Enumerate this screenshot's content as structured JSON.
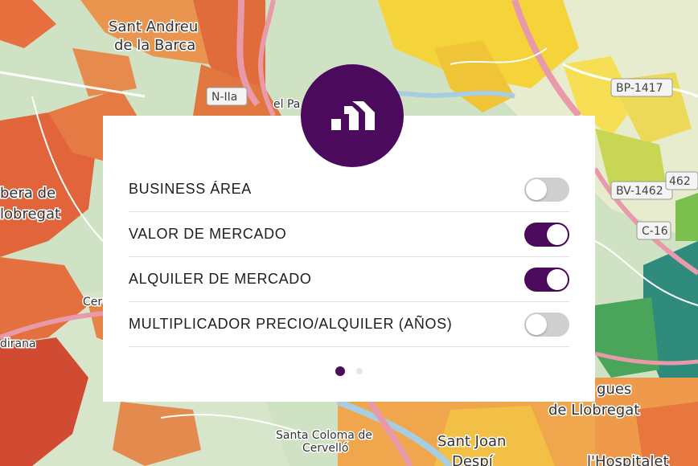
{
  "map": {
    "places": [
      {
        "name": "Sant Andreu"
      },
      {
        "name": "de la Barca"
      },
      {
        "name": "bera de"
      },
      {
        "name": "lobregat"
      },
      {
        "name": "el Pa"
      },
      {
        "name": "Cer"
      },
      {
        "name": "dirana"
      },
      {
        "name": "Santa Coloma de"
      },
      {
        "name": "Cervelló"
      },
      {
        "name": "Sant Joan"
      },
      {
        "name": "Despí"
      },
      {
        "name": "gues"
      },
      {
        "name": "de Llobregat"
      },
      {
        "name": "l'Hospitalet"
      }
    ],
    "roads": [
      "N-IIa",
      "BP-1417",
      "BV-1462",
      "C-16",
      "462"
    ]
  },
  "panel": {
    "logo_icon": "brand-logo-icon",
    "brand_color": "#4b0a5c",
    "toggles": [
      {
        "label": "BUSINESS ÁREA",
        "on": false
      },
      {
        "label": "VALOR DE MERCADO",
        "on": true
      },
      {
        "label": "ALQUILER DE MERCADO",
        "on": true
      },
      {
        "label": "MULTIPLICADOR PRECIO/ALQUILER (AÑOS)",
        "on": false
      }
    ],
    "pagination": {
      "pages": 2,
      "current": 1
    }
  }
}
